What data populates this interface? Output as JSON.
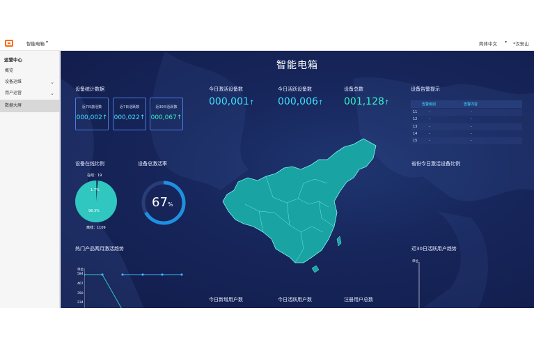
{
  "topbar": {
    "product_name": "智能电箱",
    "product_caret": "▾",
    "language": "简体中文",
    "language_caret": "▾",
    "region": "*汉安山"
  },
  "sidebar": {
    "title": "运营中心",
    "items": [
      {
        "label": "概览",
        "chevron": ""
      },
      {
        "label": "设备运维",
        "chevron": "⌄"
      },
      {
        "label": "用户运营",
        "chevron": "⌄"
      },
      {
        "label": "数据大屏",
        "chevron": ""
      }
    ]
  },
  "dashboard": {
    "title": "智能电箱",
    "stats_title": "设备统计数据",
    "stat_boxes": [
      {
        "label": "近7日激活数",
        "value": "000,002↑"
      },
      {
        "label": "近7日活跃数",
        "value": "000,022↑"
      },
      {
        "label": "近30日活跃数",
        "value": "000,067↑"
      }
    ],
    "kpis": [
      {
        "label": "今日激活设备数",
        "value": "000,001",
        "arrow": "↑"
      },
      {
        "label": "今日活跃设备数",
        "value": "000,006",
        "arrow": "↑"
      },
      {
        "label": "设备总数",
        "value": "001,128",
        "arrow": "↑"
      }
    ],
    "alarm": {
      "title": "设备告警提示",
      "headers": [
        "告警级别",
        "告警内容"
      ],
      "rows": [
        {
          "id": "11",
          "level": "-",
          "content": "-"
        },
        {
          "id": "12",
          "level": "-",
          "content": "-"
        },
        {
          "id": "13",
          "level": "-",
          "content": "-"
        },
        {
          "id": "14",
          "level": "-",
          "content": "-"
        },
        {
          "id": "15",
          "level": "-",
          "content": "-"
        }
      ]
    },
    "online_ratio": {
      "title": "设备在线比例",
      "online_label": "在线：19",
      "offline_label": "离线：1109",
      "online_pct": "1.7%",
      "offline_pct": "98.3%",
      "online_fraction": 0.017
    },
    "activation_rate": {
      "title": "设备总激活率",
      "value": "67",
      "unit": "%",
      "fraction": 0.67
    },
    "province_title": "省份今日激活设备比例",
    "trend_title": "热门产品两月激活趋势",
    "trend_unit": "单位",
    "trend_ticks": [
      "584",
      "467",
      "350",
      "234"
    ],
    "active_users_title": "近30日活跃用户趋势",
    "active_users_unit": "单位",
    "bottom_kpis": [
      {
        "label": "今日新增用户数"
      },
      {
        "label": "今日活跃用户数"
      },
      {
        "label": "注册用户总数"
      }
    ],
    "colors": {
      "accent_cyan": "#3fe0ff",
      "accent_green": "#38f0c8",
      "pie_teal": "#2fc7bf",
      "ring_blue": "#1f8fe0",
      "map_fill": "#1aa3a3"
    }
  }
}
